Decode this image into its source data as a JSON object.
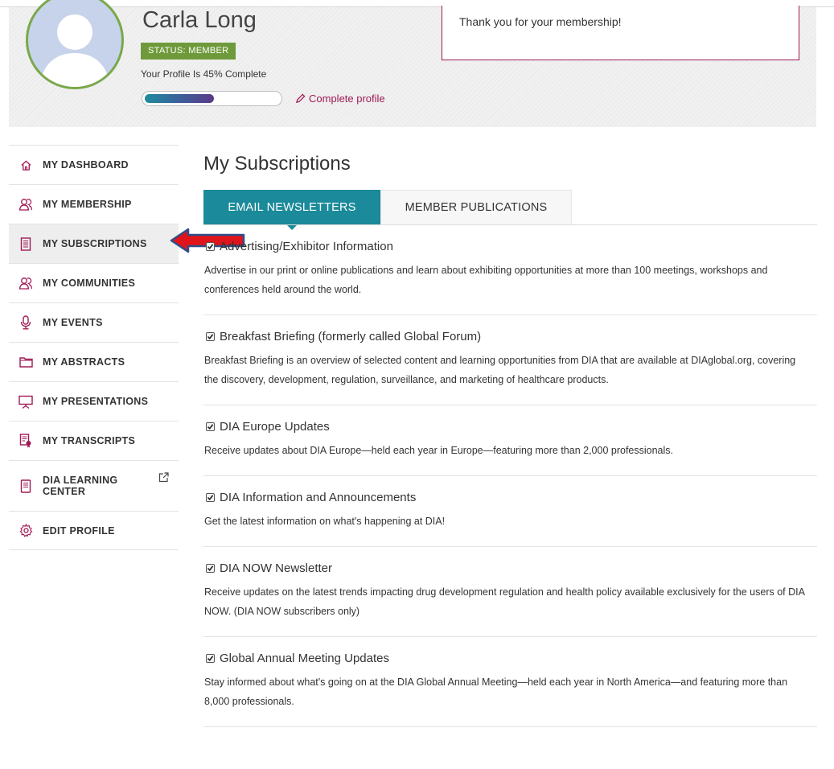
{
  "profile": {
    "name": "Carla Long",
    "status_badge": "STATUS: MEMBER",
    "completion_text": "Your Profile Is 45% Complete",
    "completion_fraction": 0.45,
    "complete_link": "Complete profile",
    "thank_you": "Thank you for your membership!"
  },
  "sidebar": {
    "items": [
      {
        "label": "MY DASHBOARD",
        "icon": "home-icon"
      },
      {
        "label": "MY MEMBERSHIP",
        "icon": "members-icon"
      },
      {
        "label": "MY SUBSCRIPTIONS",
        "icon": "document-icon",
        "active": true
      },
      {
        "label": "MY COMMUNITIES",
        "icon": "members-icon"
      },
      {
        "label": "MY EVENTS",
        "icon": "microphone-icon"
      },
      {
        "label": "MY ABSTRACTS",
        "icon": "folder-icon"
      },
      {
        "label": "MY PRESENTATIONS",
        "icon": "presentation-icon"
      },
      {
        "label": "MY TRANSCRIPTS",
        "icon": "transcript-icon"
      },
      {
        "label": "DIA LEARNING CENTER",
        "icon": "book-icon",
        "external": true
      },
      {
        "label": "EDIT PROFILE",
        "icon": "gear-icon"
      }
    ]
  },
  "main": {
    "title": "My Subscriptions",
    "tabs": [
      {
        "label": "EMAIL NEWSLETTERS",
        "active": true
      },
      {
        "label": "MEMBER PUBLICATIONS",
        "active": false
      }
    ],
    "subscriptions": [
      {
        "title": "Advertising/Exhibitor Information",
        "checked": true,
        "description": "Advertise in our print or online publications and learn about exhibiting opportunities at more than 100 meetings, workshops and conferences held around the world."
      },
      {
        "title": "Breakfast Briefing (formerly called Global Forum)",
        "checked": true,
        "description": "Breakfast Briefing is an overview of selected content and learning opportunities from DIA that are available at DIAglobal.org, covering the discovery, development, regulation, surveillance, and marketing of healthcare products."
      },
      {
        "title": "DIA Europe Updates",
        "checked": true,
        "description": "Receive updates about DIA Europe—held each year in Europe—featuring more than 2,000 professionals."
      },
      {
        "title": "DIA Information and Announcements",
        "checked": true,
        "description": "Get the latest information on what's happening at DIA!"
      },
      {
        "title": "DIA NOW Newsletter",
        "checked": true,
        "description": "Receive updates on the latest trends impacting drug development regulation and health policy available exclusively for the users of DIA NOW. (DIA NOW subscribers only)"
      },
      {
        "title": "Global Annual Meeting Updates",
        "checked": true,
        "description": "Stay informed about what's going on at the DIA Global Annual Meeting—held each year in North America—and featuring more than 8,000 professionals."
      }
    ]
  },
  "colors": {
    "accent_teal": "#1b8a9a",
    "link_magenta": "#a01a55",
    "status_green": "#6f9a3b",
    "arrow_red": "#e0141b",
    "arrow_outline": "#2d4f8a"
  }
}
